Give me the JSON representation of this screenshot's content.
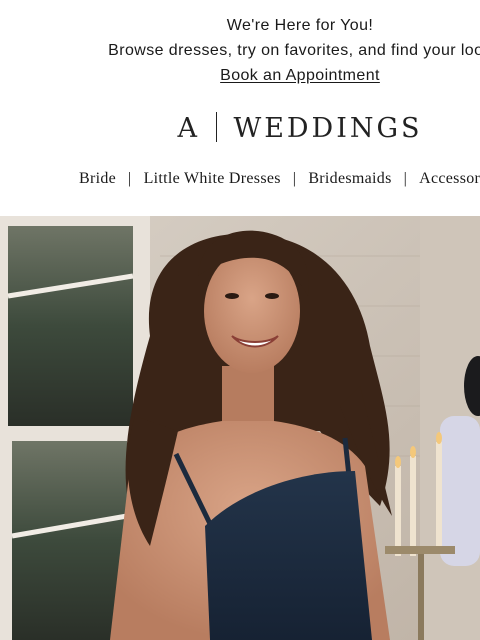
{
  "promo": {
    "headline": "We're Here for You!",
    "subtext": "Browse dresses, try on favorites, and find your look",
    "cta_label": "Book an Appointment"
  },
  "brand": {
    "mark": "A",
    "name": "WEDDINGS"
  },
  "nav": {
    "items": [
      "Bride",
      "Little White Dresses",
      "Bridesmaids",
      "Accessories"
    ],
    "separator": "|"
  },
  "hero": {
    "image": "woman-in-navy-dress-smiling"
  }
}
